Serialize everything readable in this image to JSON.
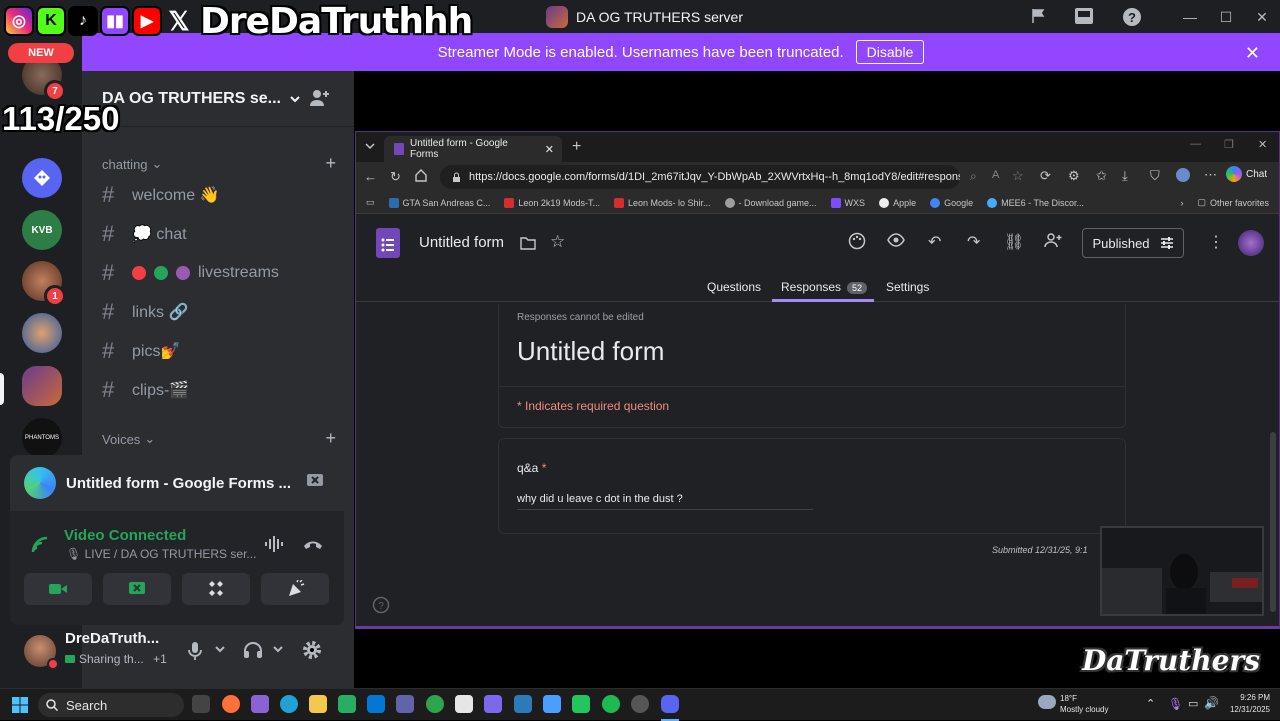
{
  "overlay": {
    "streamer_name": "DreDaTruthhh",
    "counter": "113/250",
    "logo_text": "DaTruthers"
  },
  "window": {
    "title": "DA OG TRUTHERS server"
  },
  "banner": {
    "text": "Streamer Mode is enabled. Usernames have been truncated.",
    "disable_label": "Disable"
  },
  "rail": {
    "new_label": "NEW",
    "badges": [
      "7",
      "1"
    ]
  },
  "server": {
    "name": "DA OG TRUTHERS se...",
    "categories": [
      {
        "label": "chatting"
      },
      {
        "label": "Voices"
      }
    ],
    "channels": [
      {
        "label": "welcome 👋"
      },
      {
        "label": "💭 chat"
      },
      {
        "label": "livestreams"
      },
      {
        "label": "links 🔗"
      },
      {
        "label": "pics💅"
      },
      {
        "label": "clips-🎬"
      }
    ]
  },
  "activity": {
    "title": "Untitled form - Google Forms ...",
    "status": "Video Connected",
    "substatus": "LIVE / DA OG TRUTHERS ser..."
  },
  "user": {
    "name": "DreDaTruth...",
    "status": "Sharing th...",
    "extra": "+1"
  },
  "browser": {
    "tab_title": "Untitled form - Google Forms",
    "url": "https://docs.google.com/forms/d/1DI_2m67itJqv_Y-DbWpAb_2XWVrtxHq--h_8mq1odY8/edit#response=A...",
    "chat_label": "Chat",
    "bookmarks": [
      "GTA San Andreas C...",
      "Leon 2k19 Mods-T...",
      "Leon Mods- lo Shir...",
      "- Download game...",
      "WXS",
      "Apple",
      "Google",
      "MEE6 - The Discor..."
    ],
    "other_favorites": "Other favorites"
  },
  "form": {
    "doc_title": "Untitled form",
    "publish_label": "Published",
    "tabs": {
      "questions": "Questions",
      "responses": "Responses",
      "responses_count": "52",
      "settings": "Settings"
    },
    "note": "Responses cannot be edited",
    "title": "Untitled form",
    "required_note": "* Indicates required question",
    "question_label": "q&a",
    "required_star": "*",
    "answer": "why did u leave c dot in the dust ?",
    "submitted": "Submitted 12/31/25, 9:1"
  },
  "taskbar": {
    "search_label": "Search",
    "weather_temp": "18°F",
    "weather_desc": "Mostly cloudy",
    "time": "9:26 PM",
    "date": "12/31/2025"
  },
  "colors": {
    "discord_bg": "#313338",
    "sidebar": "#2b2d31",
    "rail": "#1e1f22",
    "banner": "#9146ff",
    "connected": "#23a55a",
    "form_accent": "#7248b9"
  }
}
